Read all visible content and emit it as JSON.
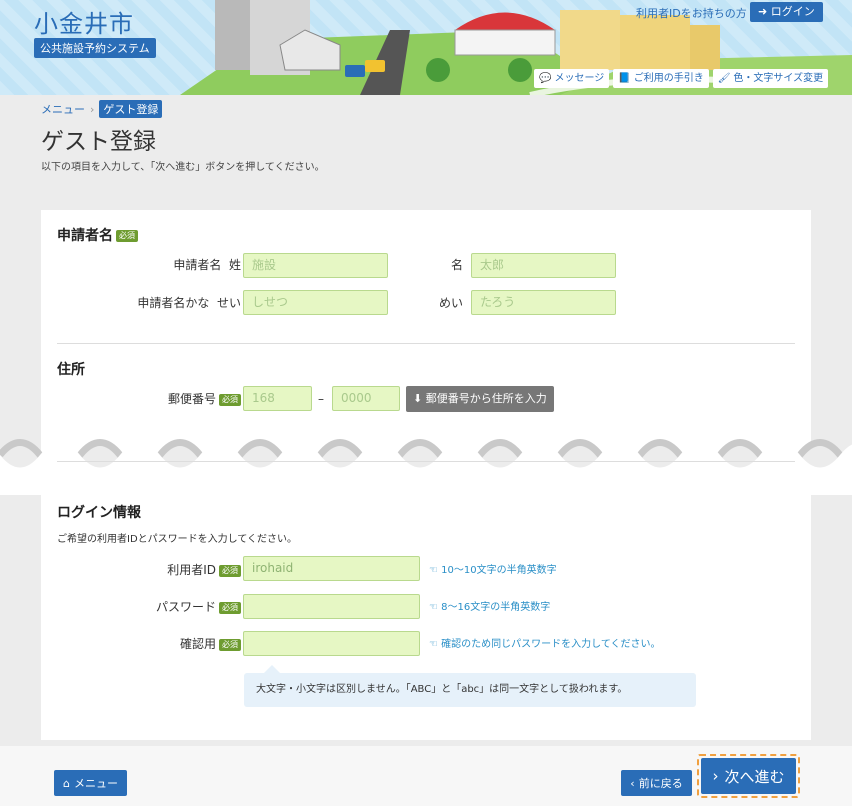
{
  "header": {
    "site_title": "小金井市",
    "system_name": "公共施設予約システム",
    "login_hint": "利用者IDをお持ちの方",
    "login_label": "ログイン",
    "links": {
      "message": "メッセージ",
      "guide": "ご利用の手引き",
      "display": "色・文字サイズ変更"
    }
  },
  "breadcrumb": {
    "menu": "メニュー",
    "current": "ゲスト登録"
  },
  "page": {
    "title": "ゲスト登録",
    "description": "以下の項目を入力して、「次へ進む」ボタンを押してください。"
  },
  "required_badge": "必須",
  "applicant": {
    "section_title": "申請者名",
    "name_label": "申請者名",
    "sei_label": "姓",
    "mei_label": "名",
    "sei_placeholder": "施設",
    "mei_placeholder": "太郎",
    "kana_label": "申請者名かな",
    "kana_sei_label": "せい",
    "kana_mei_label": "めい",
    "kana_sei_placeholder": "しせつ",
    "kana_mei_placeholder": "たろう"
  },
  "address": {
    "section_title": "住所",
    "zip_label": "郵便番号",
    "zip1_placeholder": "168",
    "zip_dash": "–",
    "zip2_placeholder": "0000",
    "zip_button": "郵便番号から住所を入力"
  },
  "login_info": {
    "section_title": "ログイン情報",
    "description": "ご希望の利用者IDとパスワードを入力してください。",
    "userid_label": "利用者ID",
    "userid_value": "irohaid",
    "userid_hint": "10～10文字の半角英数字",
    "password_label": "パスワード",
    "password_hint": "8～16文字の半角英数字",
    "confirm_label": "確認用",
    "confirm_hint": "確認のため同じパスワードを入力してください。",
    "tooltip": "大文字・小文字は区別しません。「ABC」と「abc」は同一文字として扱われます。"
  },
  "footer": {
    "menu_button": "メニュー",
    "back_button": "前に戻る",
    "next_button": "次へ進む"
  },
  "colors": {
    "primary": "#2a6db7",
    "input_bg": "#e6f7c4",
    "required": "#6e9c30",
    "focus": "#f0a040"
  }
}
